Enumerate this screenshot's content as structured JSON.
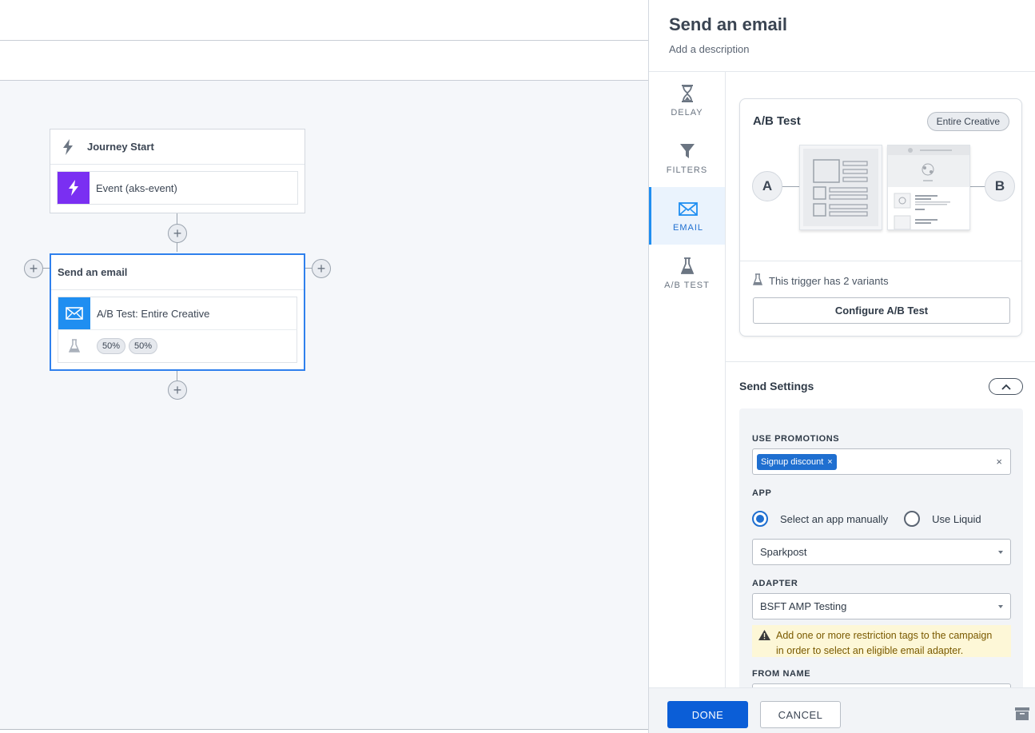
{
  "canvas": {
    "journey_start": {
      "title": "Journey Start",
      "trigger_label": "Event (aks-event)"
    },
    "email_node": {
      "title": "Send an email",
      "ab_label": "A/B Test: Entire Creative",
      "splits": [
        "50%",
        "50%"
      ]
    }
  },
  "panel": {
    "title": "Send an email",
    "description": "Add a description",
    "rail": [
      {
        "label": "DELAY",
        "icon": "hourglass-icon"
      },
      {
        "label": "FILTERS",
        "icon": "filter-icon"
      },
      {
        "label": "EMAIL",
        "icon": "envelope-icon",
        "active": true
      },
      {
        "label": "A/B TEST",
        "icon": "flask-icon"
      }
    ],
    "ab_test": {
      "title": "A/B Test",
      "badge": "Entire Creative",
      "variant_a": "A",
      "variant_b": "B",
      "variants_text": "This trigger has 2 variants",
      "configure_label": "Configure A/B Test"
    },
    "send_settings": {
      "title": "Send Settings",
      "promotions_label": "USE PROMOTIONS",
      "promotion_tag": "Signup discount",
      "app_label": "APP",
      "radio_manual": "Select an app manually",
      "radio_liquid": "Use Liquid",
      "app_value": "Sparkpost",
      "adapter_label": "ADAPTER",
      "adapter_value": "BSFT AMP Testing",
      "warning_line1": "Add one or more restriction tags to the campaign",
      "warning_line2": "in order to select an eligible email adapter.",
      "from_name_label": "FROM NAME"
    },
    "footer": {
      "done_label": "DONE",
      "cancel_label": "CANCEL"
    }
  },
  "colors": {
    "primary": "#0b5ed7",
    "accent_blue": "#1f8ef1",
    "trigger_purple": "#7a2ff2",
    "warning_bg": "#fdf7d7"
  }
}
